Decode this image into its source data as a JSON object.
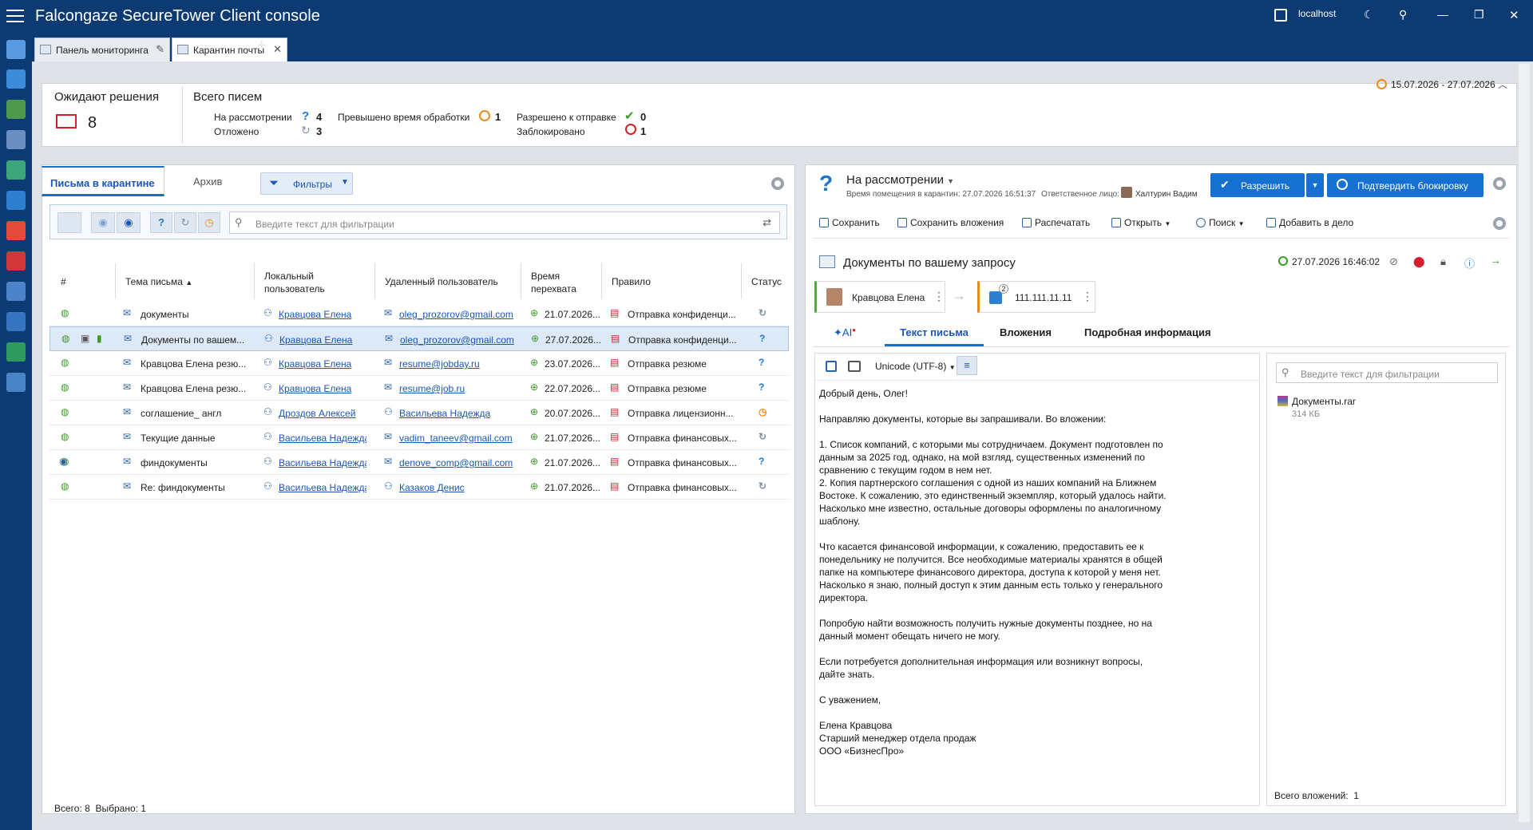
{
  "app": {
    "title_a": "Falcongaze SecureTower",
    "title_b": "Client console",
    "host": "localhost"
  },
  "tabs": [
    {
      "label": "Панель мониторинга"
    },
    {
      "label": "Карантин почты"
    }
  ],
  "summary": {
    "pending_title": "Ожидают решения",
    "pending_count": "8",
    "total_title": "Всего писем",
    "on_review_label": "На рассмотрении",
    "on_review_count": "4",
    "postponed_label": "Отложено",
    "postponed_count": "3",
    "exceeded_label": "Превышено время обработки",
    "exceeded_count": "1",
    "allowed_label": "Разрешено к отправке",
    "allowed_count": "0",
    "blocked_label": "Заблокировано",
    "blocked_count": "1",
    "date_range": "15.07.2026 - 27.07.2026"
  },
  "left": {
    "tab_quarantine": "Письма в карантине",
    "tab_archive": "Архив",
    "filters_label": "Фильтры",
    "search_placeholder": "Введите текст для фильтрации",
    "columns": {
      "num": "#",
      "subject": "Тема письма",
      "local": "Локальный пользователь",
      "remote": "Удаленный пользователь",
      "time": "Время перехвата",
      "rule": "Правило",
      "status": "Статус"
    },
    "footer": "Всего: 8  Выбрано: 1"
  },
  "rows": [
    {
      "subject": "документы",
      "local": "Кравцова Елена",
      "remote": "oleg_prozorov@gmail.com",
      "time": "21.07.2026...",
      "rule": "Отправка конфиденци...",
      "status": "postponed"
    },
    {
      "subject": "Документы по вашем...",
      "local": "Кравцова Елена",
      "remote": "oleg_prozorov@gmail.com",
      "time": "27.07.2026...",
      "rule": "Отправка конфиденци...",
      "status": "review"
    },
    {
      "subject": "Кравцова Елена резю...",
      "local": "Кравцова Елена",
      "remote": "resume@jobday.ru",
      "time": "23.07.2026...",
      "rule": "Отправка резюме",
      "status": "review"
    },
    {
      "subject": "Кравцова Елена резю...",
      "local": "Кравцова Елена",
      "remote": "resume@job.ru",
      "time": "22.07.2026...",
      "rule": "Отправка резюме",
      "status": "review"
    },
    {
      "subject": "соглашение_ англ",
      "local": "Дроздов Алексей",
      "remote": "Васильева Надежда",
      "time": "20.07.2026...",
      "rule": "Отправка лицензионн...",
      "status": "exceeded"
    },
    {
      "subject": "Текущие данные",
      "local": "Васильева Надежда",
      "remote": "vadim_taneev@gmail.com",
      "time": "21.07.2026...",
      "rule": "Отправка финансовых...",
      "status": "postponed"
    },
    {
      "subject": "финдокументы",
      "local": "Васильева Надежда",
      "remote": "denove_comp@gmail.com",
      "time": "21.07.2026...",
      "rule": "Отправка финансовых...",
      "status": "review"
    },
    {
      "subject": "Re: финдокументы",
      "local": "Васильева Надежда",
      "remote": "Казаков Денис",
      "time": "21.07.2026...",
      "rule": "Отправка финансовых...",
      "status": "postponed"
    }
  ],
  "right": {
    "status": "На рассмотрении",
    "placed": "Время помещения в карантин: 27.07.2026 16:51:37",
    "responsible_label": "Ответственное лицо:",
    "responsible": "Халтурин Вадим",
    "allow_btn": "Разрешить",
    "block_btn": "Подтвердить блокировку",
    "tools": [
      "Сохранить",
      "Сохранить вложения",
      "Распечатать",
      "Открыть",
      "Поиск",
      "Добавить в дело"
    ],
    "subject": "Документы по вашему запросу",
    "date": "27.07.2026 16:46:02",
    "sender": "Кравцова Елена",
    "recipient": "111.111.11.11",
    "recipient_badge": "2",
    "tabs": [
      "AI",
      "Текст письма",
      "Вложения",
      "Подробная информация"
    ],
    "encoding": "Unicode (UTF-8)",
    "attach_placeholder": "Введите текст для фильтрации",
    "attachment_name": "Документы.rar",
    "attachment_size": "314 КБ",
    "attach_total": "Всего вложений:  1"
  },
  "body": [
    "Добрый день, Олег!",
    "Направляю документы, которые вы запрашивали. Во вложении:",
    "1. Список компаний, с которыми мы сотрудничаем. Документ подготовлен по данным за 2025 год, однако, на мой взгляд, существенных изменений по сравнению с текущим годом в нем нет.\n2. Копия партнерского соглашения с одной из наших компаний на Ближнем Востоке. К сожалению, это единственный экземпляр, который удалось найти. Насколько мне известно, остальные договоры оформлены по аналогичному шаблону.",
    "Что касается финансовой информации, к сожалению, предоставить ее к понедельнику не получится. Все необходимые материалы хранятся в общей папке на компьютере финансового директора, доступа к которой у меня нет. Насколько я знаю, полный доступ к этим данным есть только у генерального директора.",
    "Попробую найти возможность получить нужные документы позднее, но на данный момент обещать ничего не могу.",
    "Если потребуется дополнительная информация или возникнут вопросы, дайте знать.",
    "С уважением,",
    "Елена Кравцова\nСтарший менеджер отдела продаж\nООО «БизнесПро»"
  ],
  "colors": {
    "titlebar": "#0c3a72",
    "accent": "#1670d1",
    "review": "#1a78d4",
    "postponed": "#8090a8",
    "exceeded": "#f08a12",
    "blocked": "#d21f2b",
    "allowed": "#3a9a25"
  }
}
